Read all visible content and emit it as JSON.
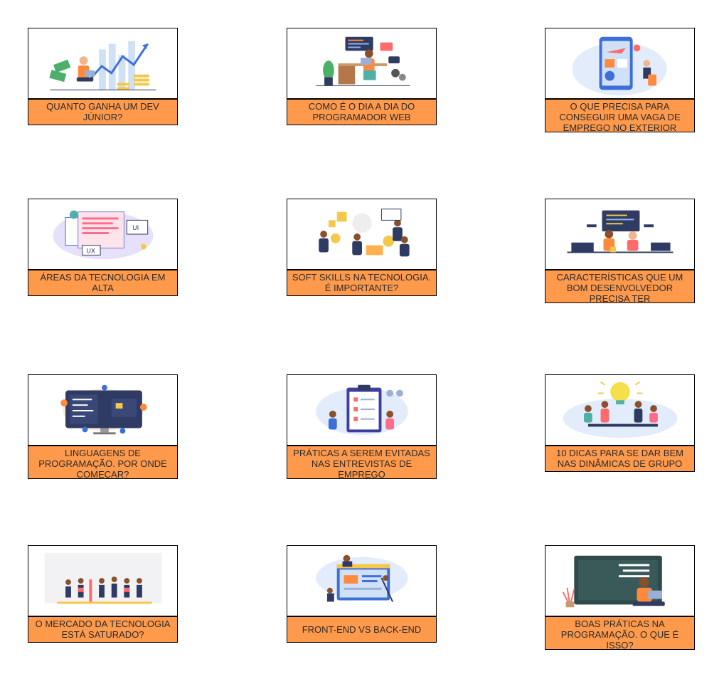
{
  "colors": {
    "caption_bg": "#ff9a4d",
    "caption_text": "#2b2b2b",
    "border": "#000000",
    "accent_blue": "#3d6fd8",
    "accent_yellow": "#f6c84a"
  },
  "cards": [
    {
      "title": "QUANTO GANHA UM DEV JÚNIOR?",
      "image": "developer-salary-chart-illustration"
    },
    {
      "title": "COMO É O DIA A DIA DO PROGRAMADOR WEB",
      "image": "programmer-desk-illustration"
    },
    {
      "title": "O QUE PRECISA PARA CONSEGUIR UMA VAGA DE EMPREGO NO EXTERIOR",
      "image": "travel-abroad-phone-illustration"
    },
    {
      "title": "ÁREAS DA TECNOLOGIA EM ALTA",
      "image": "ui-ux-windows-illustration"
    },
    {
      "title": "SOFT SKILLS NA TECNOLOGIA. É IMPORTANTE?",
      "image": "soft-skills-team-illustration"
    },
    {
      "title": "CARACTERÍSTICAS QUE UM BOM DESENVOLVEDOR PRECISA TER",
      "image": "developers-at-desk-illustration"
    },
    {
      "title": "LINGUAGENS DE PROGRAMAÇÃO. POR ONDE COMEÇAR?",
      "image": "code-monitor-illustration"
    },
    {
      "title": "PRÁTICAS A SEREM EVITADAS NAS ENTREVISTAS DE EMPREGO",
      "image": "job-interview-clipboard-illustration"
    },
    {
      "title": "10 DICAS PARA SE DAR BEM NAS DINÂMICAS DE GRUPO",
      "image": "group-dynamics-lightbulb-illustration"
    },
    {
      "title": "O MERCADO DA TECNOLOGIA ESTÁ SATURADO?",
      "image": "tech-market-race-illustration"
    },
    {
      "title": "FRONT-END vs BACK-END",
      "image": "frontend-backend-illustration"
    },
    {
      "title": "BOAS PRÁTICAS NA PROGRAMAÇÃO. O QUE É ISSO?",
      "image": "developer-with-laptop-illustration"
    }
  ]
}
